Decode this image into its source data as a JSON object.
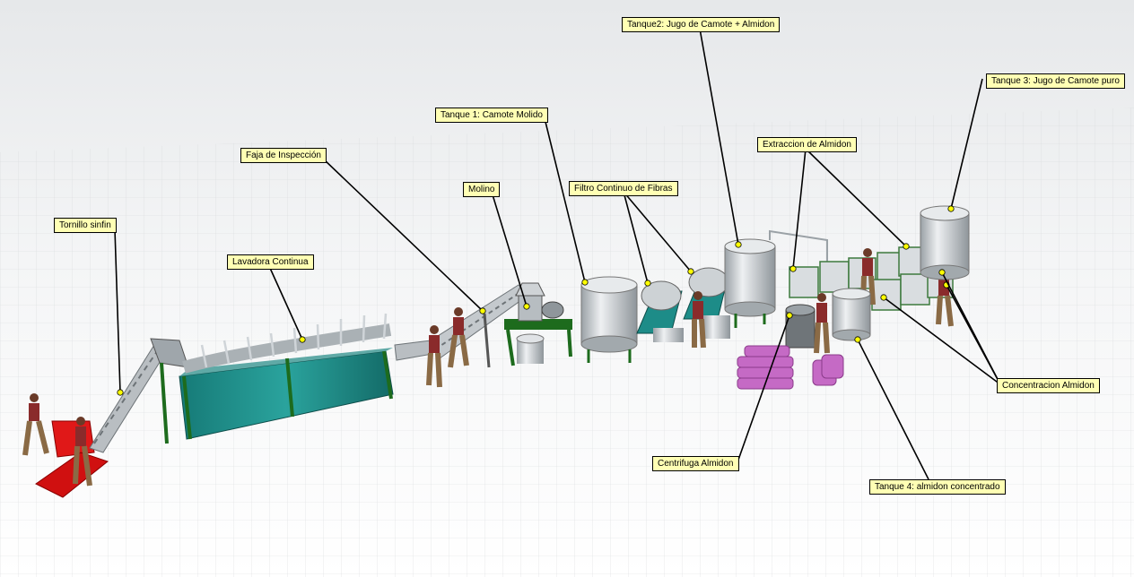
{
  "scene": {
    "callouts": [
      {
        "id": "tornillo",
        "label": "Tornillo sinfin"
      },
      {
        "id": "lavadora",
        "label": "Lavadora Continua"
      },
      {
        "id": "faja",
        "label": "Faja de Inspección"
      },
      {
        "id": "molino",
        "label": "Molino"
      },
      {
        "id": "tanque1",
        "label": "Tanque 1: Camote Molido"
      },
      {
        "id": "filtro",
        "label": "Filtro Continuo de Fibras"
      },
      {
        "id": "tanque2",
        "label": "Tanque2: Jugo de Camote + Almidon"
      },
      {
        "id": "extraccion",
        "label": "Extraccion de Almidon"
      },
      {
        "id": "tanque3",
        "label": "Tanque 3: Jugo de Camote puro"
      },
      {
        "id": "concentracion",
        "label": "Concentracion Almidon"
      },
      {
        "id": "centrifuga",
        "label": "Centrifuga Almidon"
      },
      {
        "id": "tanque4",
        "label": "Tanque 4: almidon concentrado"
      }
    ]
  },
  "colors": {
    "callout_bg": "#ffffb4",
    "washer_tank": "#1d8c88",
    "frame_green": "#1d6b1d",
    "steel": "#c4c9cd",
    "worker_shirt": "#8a2b2b",
    "worker_pants": "#8a6a45",
    "bags": "#c56ac5",
    "input_bins": "#e01818"
  }
}
